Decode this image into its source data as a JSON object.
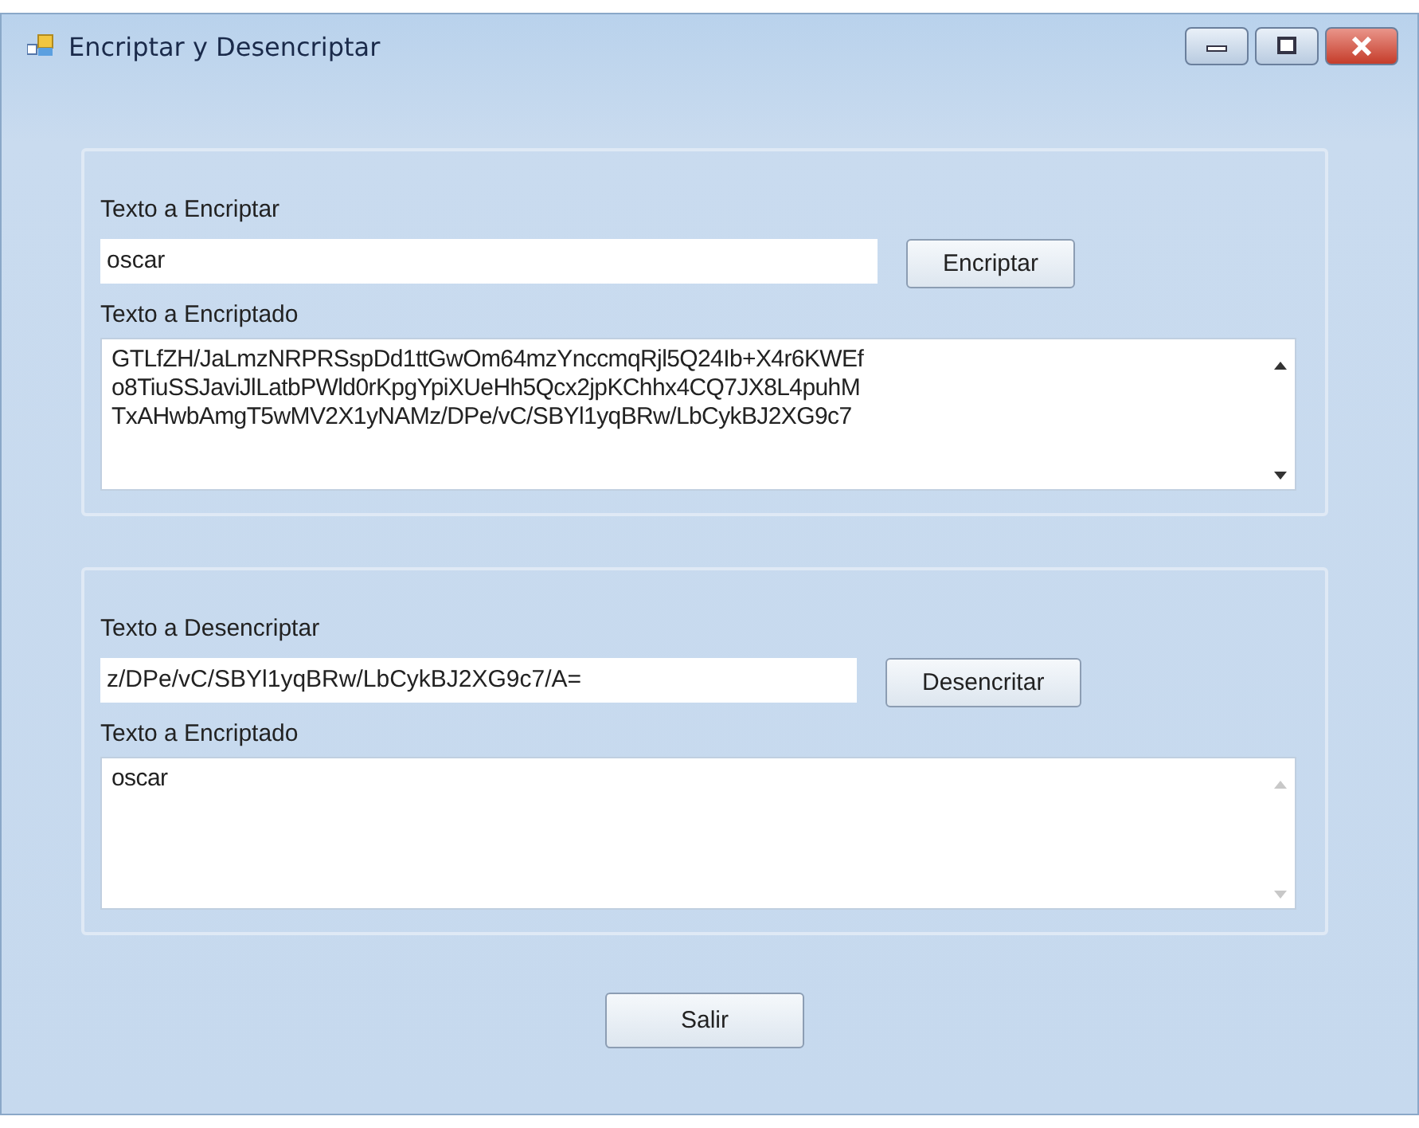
{
  "window": {
    "title": "Encriptar y Desencriptar"
  },
  "encrypt_group": {
    "input_label": "Texto a Encriptar",
    "input_value": "oscar",
    "button": "Encriptar",
    "output_label": "Texto a Encriptado",
    "output_lines": [
      "GTLfZH/JaLmzNRPRSspDd1ttGwOm64mzYnccmqRjl5Q24Ib+X4r6KWEf",
      "o8TiuSSJaviJlLatbPWld0rKpgYpiXUeHh5Qcx2jpKChhx4CQ7JX8L4puhM",
      "TxAHwbAmgT5wMV2X1yNAMz/DPe/vC/SBYl1yqBRw/LbCykBJ2XG9c7"
    ],
    "output_scroll_enabled": true
  },
  "decrypt_group": {
    "input_label": "Texto a Desencriptar",
    "input_value": "z/DPe/vC/SBYl1yqBRw/LbCykBJ2XG9c7/A=",
    "button": "Desencritar",
    "output_label": "Texto a Encriptado",
    "output_lines": [
      "oscar"
    ],
    "output_scroll_enabled": false
  },
  "exit_button": "Salir"
}
